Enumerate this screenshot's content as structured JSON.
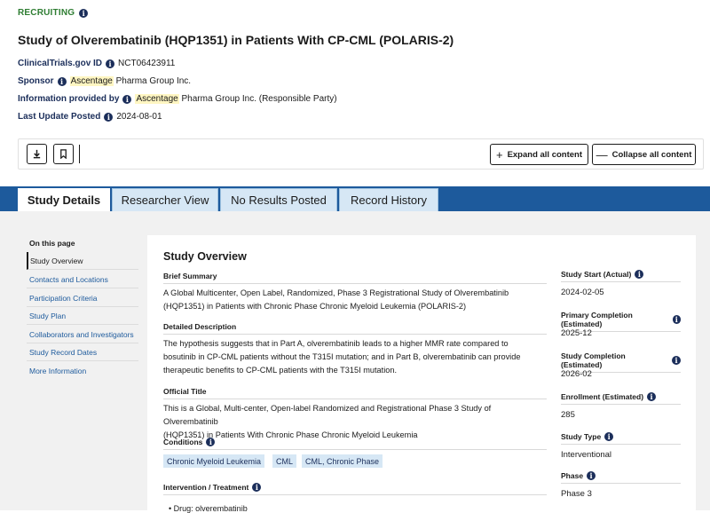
{
  "header": {
    "status": "RECRUITING",
    "title": "Study of Olverembatinib (HQP1351) in Patients With CP-CML (POLARIS-2)",
    "id_label": "ClinicalTrials.gov ID",
    "id_value": "NCT06423911",
    "sponsor_label": "Sponsor",
    "sponsor_hl": "Ascentage",
    "sponsor_rest": " Pharma Group Inc.",
    "provided_label": "Information provided by",
    "provided_hl": "Ascentage",
    "provided_rest": " Pharma Group Inc. (Responsible Party)",
    "update_label": "Last Update Posted",
    "update_value": "2024-08-01"
  },
  "toolbar": {
    "download_icon": "download-icon",
    "bookmark_icon": "bookmark-icon",
    "expand_label": "Expand all content",
    "collapse_label": "Collapse all content"
  },
  "tabs": [
    {
      "label": "Study Details"
    },
    {
      "label": "Researcher View"
    },
    {
      "label": "No Results Posted"
    },
    {
      "label": "Record History"
    }
  ],
  "on_this_page": {
    "title": "On this page",
    "items": [
      {
        "label": "Study Overview"
      },
      {
        "label": "Contacts and Locations"
      },
      {
        "label": "Participation Criteria"
      },
      {
        "label": "Study Plan"
      },
      {
        "label": "Collaborators and Investigators"
      },
      {
        "label": "Study Record Dates"
      },
      {
        "label": "More Information"
      }
    ]
  },
  "overview": {
    "title": "Study Overview",
    "brief_summary_h": "Brief Summary",
    "brief_summary_1": "A Global Multicenter, Open Label, Randomized, Phase 3 Registrational Study of Olverembatinib",
    "brief_summary_2": "(HQP1351) in Patients with Chronic Phase Chronic Myeloid Leukemia (POLARIS-2)",
    "detailed_h": "Detailed Description",
    "detailed_1": "The hypothesis suggests that in Part A, olverembatinib leads to a higher MMR rate compared to",
    "detailed_2": "bosutinib in CP-CML patients without the T315I mutation; and in Part B, olverembatinib can provide",
    "detailed_3": "therapeutic benefits to CP-CML patients with the T315I mutation.",
    "official_h": "Official Title",
    "official_1": "This is a Global, Multi-center, Open-label Randomized and Registrational Phase 3 Study of Olverembatinib",
    "official_2": "(HQP1351) in Patients With Chronic Phase Chronic Myeloid Leukemia",
    "conditions_h": "Conditions",
    "conditions": [
      "Chronic Myeloid Leukemia",
      "CML",
      "CML, Chronic Phase"
    ],
    "intervention_h": "Intervention / Treatment",
    "intervention_1": "Drug: olverembatinib"
  },
  "side": {
    "start_h": "Study Start (Actual)",
    "start_v": "2024-02-05",
    "primary_h": "Primary Completion (Estimated)",
    "primary_v": "2025-12",
    "completion_h": "Study Completion (Estimated)",
    "completion_v": "2026-02",
    "enrollment_h": "Enrollment (Estimated)",
    "enrollment_v": "285",
    "type_h": "Study Type",
    "type_v": "Interventional",
    "phase_h": "Phase",
    "phase_v": "Phase 3"
  },
  "colors": {
    "accent": "#1d5a9c",
    "status_green": "#2e7d32",
    "chip_bg": "#d6e7f5",
    "highlight": "#fff6c2"
  }
}
